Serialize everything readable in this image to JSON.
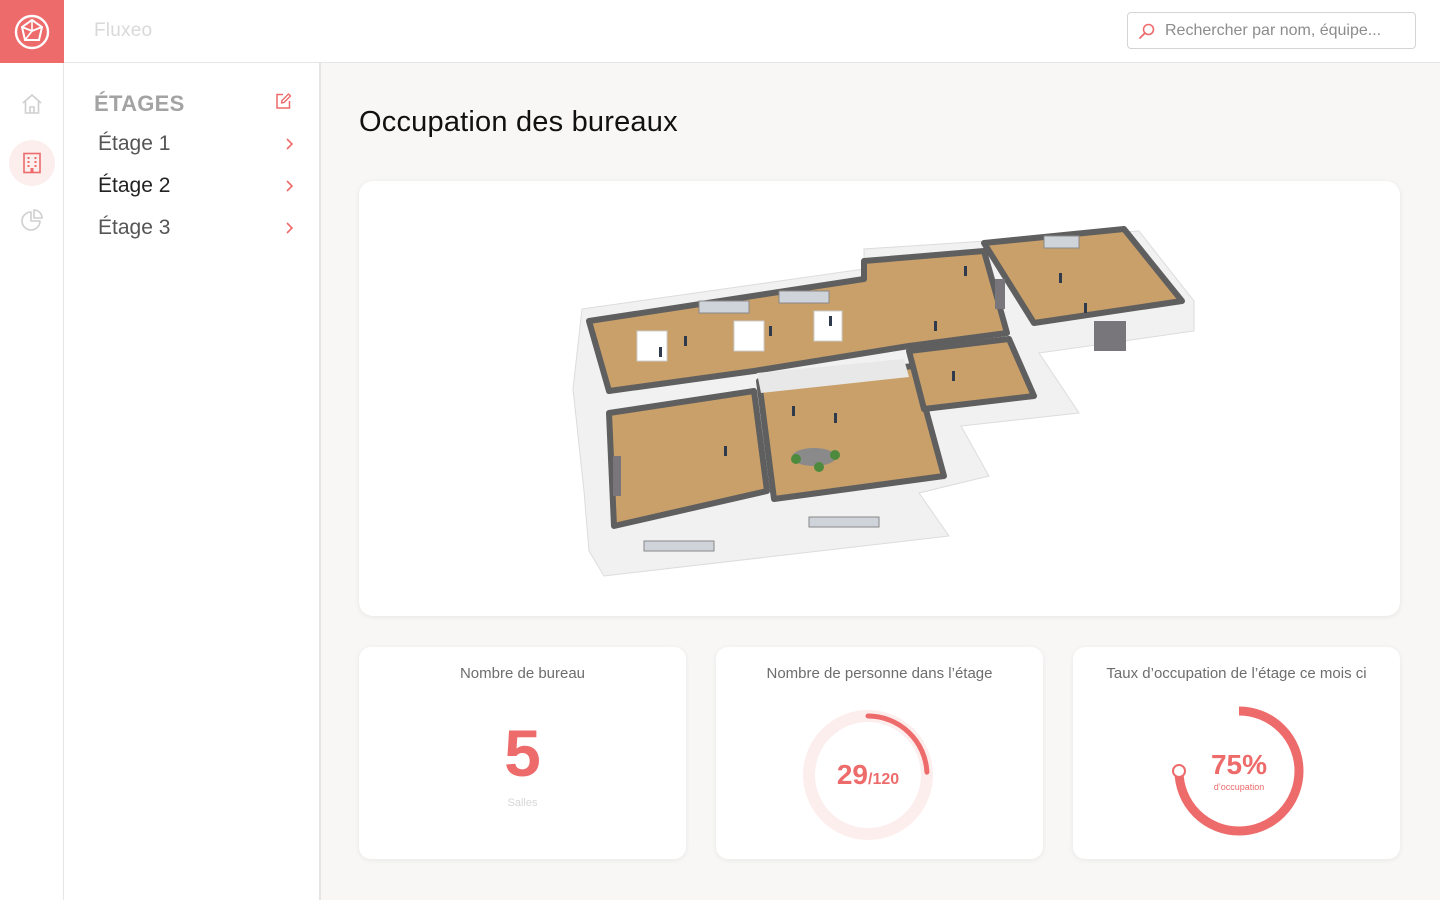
{
  "app": {
    "title": "Fluxeo"
  },
  "search": {
    "placeholder": "Rechercher par nom, équipe..."
  },
  "rail": {
    "items": [
      "home-icon",
      "building-icon",
      "pie-chart-icon"
    ],
    "active": 1
  },
  "floors": {
    "title": "ÉTAGES",
    "items": [
      {
        "label": "Étage 1"
      },
      {
        "label": "Étage 2"
      },
      {
        "label": "Étage 3"
      }
    ],
    "selected": 1
  },
  "main": {
    "title": "Occupation des bureaux"
  },
  "stats": {
    "offices": {
      "title": "Nombre de bureau",
      "value": "5",
      "caption": "Salles"
    },
    "people": {
      "title": "Nombre de personne dans l’étage",
      "value": "29",
      "total": "/120",
      "fraction": 0.242
    },
    "occupancy": {
      "title": "Taux d’occupation de l’étage ce mois ci",
      "value": "75%",
      "caption": "d’occupation",
      "fraction": 0.75
    }
  },
  "colors": {
    "accent": "#ee6b6b",
    "accent_light": "#fdeeee",
    "floor": "#c9a06a",
    "wall": "#5f5f5f"
  }
}
